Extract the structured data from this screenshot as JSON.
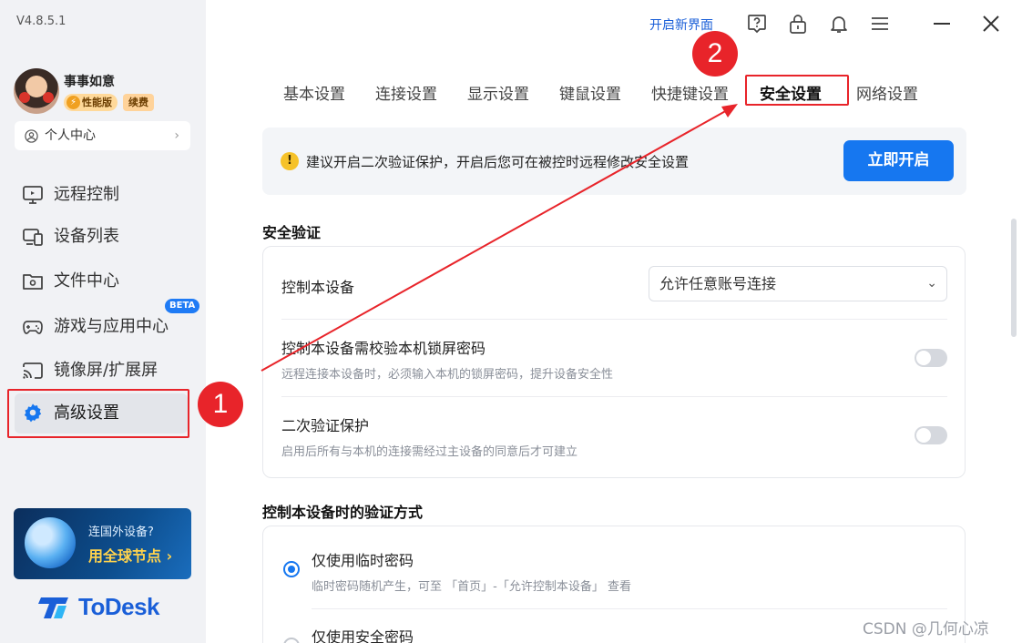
{
  "app": {
    "version": "V4.8.5.1",
    "brand": "ToDesk",
    "accent_color": "#1677f0",
    "annotation_color": "#e8242a"
  },
  "user": {
    "name": "事事如意",
    "tier_badge": "性能版",
    "renew_badge": "续费",
    "profile_link": "个人中心"
  },
  "sidebar": {
    "items": [
      {
        "label": "远程控制",
        "icon": "monitor-icon"
      },
      {
        "label": "设备列表",
        "icon": "devices-icon"
      },
      {
        "label": "文件中心",
        "icon": "folder-icon"
      },
      {
        "label": "游戏与应用中心",
        "icon": "gamepad-icon",
        "badge": "BETA"
      },
      {
        "label": "镜像屏/扩展屏",
        "icon": "cast-icon"
      },
      {
        "label": "高级设置",
        "icon": "gear-icon",
        "active": true
      }
    ],
    "promo": {
      "line1": "连国外设备?",
      "line2": "用全球节点 ›"
    }
  },
  "topbar": {
    "new_ui_link": "开启新界面"
  },
  "tabs": [
    {
      "label": "基本设置"
    },
    {
      "label": "连接设置"
    },
    {
      "label": "显示设置"
    },
    {
      "label": "键鼠设置"
    },
    {
      "label": "快捷键设置"
    },
    {
      "label": "安全设置",
      "active": true
    },
    {
      "label": "网络设置"
    }
  ],
  "banner": {
    "message": "建议开启二次验证保护，开启后您可在被控时远程修改安全设置",
    "button": "立即开启"
  },
  "security_verification": {
    "title": "安全验证",
    "control_device": {
      "label": "控制本设备",
      "select_value": "允许任意账号连接"
    },
    "lock_password": {
      "label": "控制本设备需校验本机锁屏密码",
      "desc": "远程连接本设备时，必须输入本机的锁屏密码，提升设备安全性",
      "enabled": false
    },
    "two_factor": {
      "label": "二次验证保护",
      "desc": "启用后所有与本机的连接需经过主设备的同意后才可建立",
      "enabled": false
    }
  },
  "verification_method": {
    "title": "控制本设备时的验证方式",
    "options": [
      {
        "label": "仅使用临时密码",
        "desc": "临时密码随机产生，可至 「首页」-「允许控制本设备」 查看",
        "selected": true
      },
      {
        "label": "仅使用安全密码",
        "selected": false
      }
    ]
  },
  "annotations": {
    "marker1": "1",
    "marker2": "2"
  },
  "watermark": "CSDN @几何心凉"
}
